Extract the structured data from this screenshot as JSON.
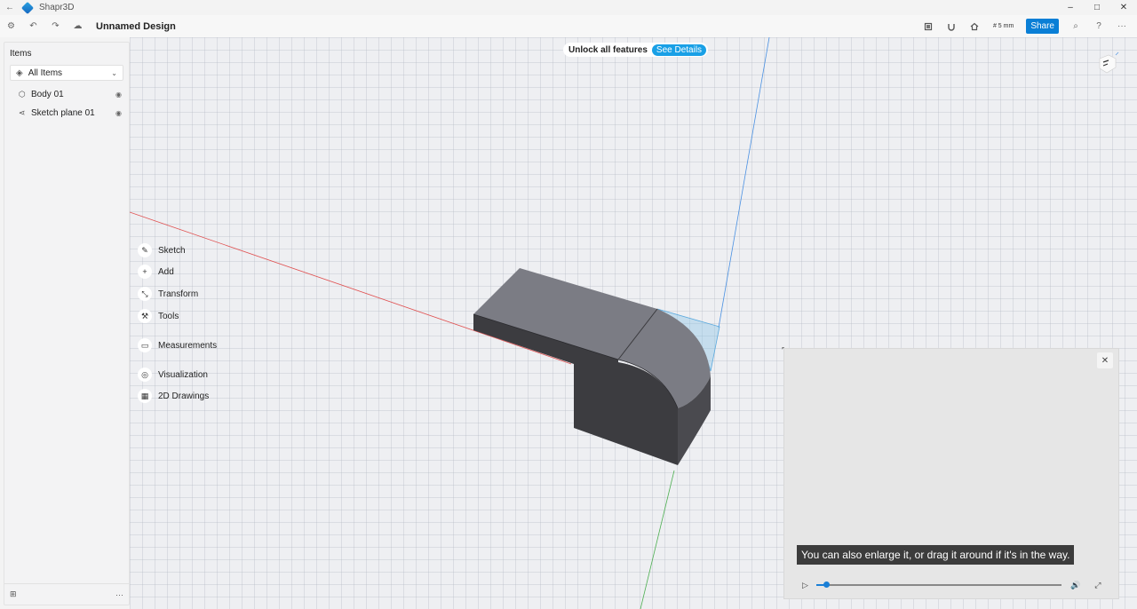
{
  "app": {
    "title": "Shapr3D",
    "back_icon": "back-arrow-icon"
  },
  "window_controls": {
    "minimize": "–",
    "maximize": "□",
    "close": "✕"
  },
  "toolbar": {
    "settings_glyph": "⚙",
    "undo_glyph": "↶",
    "redo_glyph": "↷",
    "cloud_glyph": "☁",
    "document_title": "Unnamed Design",
    "grid_label": "# 5 mm",
    "share_label": "Share",
    "search_glyph": "⌕",
    "help_glyph": "?",
    "more_glyph": "···"
  },
  "banner": {
    "text": "Unlock all features",
    "button_label": "See Details"
  },
  "items_panel": {
    "title": "Items",
    "filter_selected": "All Items",
    "items": [
      {
        "label": "Body 01",
        "icon": "body-cube-icon"
      },
      {
        "label": "Sketch plane 01",
        "icon": "sketch-plane-icon"
      }
    ],
    "footer_more": "···"
  },
  "tools": [
    {
      "label": "Sketch",
      "icon": "pencil-icon",
      "glyph": "✎"
    },
    {
      "label": "Add",
      "icon": "plus-icon",
      "glyph": "+"
    },
    {
      "label": "Transform",
      "icon": "transform-icon",
      "glyph": "⤡"
    },
    {
      "label": "Tools",
      "icon": "hammer-icon",
      "glyph": "⚒"
    },
    {
      "label": "Measurements",
      "icon": "ruler-icon",
      "glyph": "▭"
    },
    {
      "label": "Visualization",
      "icon": "visualization-icon",
      "glyph": "◎"
    },
    {
      "label": "2D Drawings",
      "icon": "drawing-icon",
      "glyph": "▦"
    }
  ],
  "video": {
    "caption": "You can also enlarge it, or drag it around if it's in the way.",
    "progress": 0.04,
    "close_glyph": "✕",
    "play_glyph": "▷",
    "volume_glyph": "🔊",
    "fullscreen_glyph": "⤢"
  },
  "colors": {
    "accent": "#0a7fd6",
    "banner_button": "#19a0e6",
    "x_axis": "#e05050",
    "z_axis": "#4a90e2",
    "y_axis": "#4caf50",
    "body": "#555559"
  }
}
